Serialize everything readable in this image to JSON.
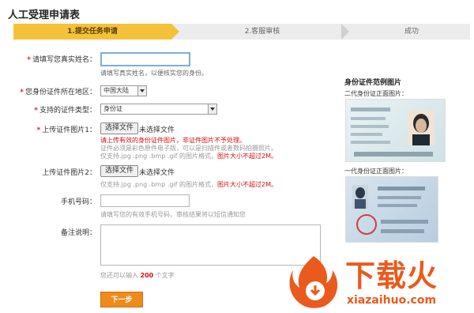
{
  "page": {
    "title": "人工受理申请表"
  },
  "steps": [
    {
      "label": "1.提交任务申请"
    },
    {
      "label": "2.客服审核"
    },
    {
      "label": "成功"
    }
  ],
  "form": {
    "name": {
      "label": "请填写您真实姓名：",
      "value": "",
      "hint": "请填写真实姓名，以便核实您的身份。"
    },
    "region": {
      "label": "您身份证件所在地区：",
      "value": "中国大陆"
    },
    "idtype": {
      "label": "支持的证件类型：",
      "value": "身份证"
    },
    "upload1": {
      "label": "上传证件图片1：",
      "button": "选择文件",
      "status": "未选择文件",
      "warn": "请上传有效的身份证件图片，非证件图片不予处理。",
      "hint1": "证件必须是彩色原件电子版，可以是扫描件或者数码拍摄照片。",
      "hint2": "仅支持.jpg .png .bmp .gif 的图片格式，",
      "limit": "图片大小不超过2M。"
    },
    "upload2": {
      "label": "上传证件图片2：",
      "button": "选择文件",
      "status": "未选择文件",
      "hint": "仅支持.jpg .png .bmp .gif 的图片格式，",
      "limit": "图片大小不超过2M。"
    },
    "phone": {
      "label": "手机号码：",
      "value": "",
      "hint": "请填写您的有效手机号码，审核结果将以短信通知您"
    },
    "remark": {
      "label": "备注说明：",
      "value": "",
      "hint_prefix": "您还可以输入",
      "count": "200",
      "hint_suffix": "个文字"
    },
    "submit": "下一步"
  },
  "sample_panel": {
    "title": "身份证件范例图片",
    "second_gen": "二代身份证正面图片：",
    "first_gen": "一代身份证正面图片："
  },
  "watermark": {
    "text": "下载火",
    "url": "xiazaihuo.com"
  },
  "colors": {
    "step_active": "#f3c23a",
    "submit": "#ef8a1c",
    "required": "#e02020",
    "watermark": "#ea5a1c"
  }
}
